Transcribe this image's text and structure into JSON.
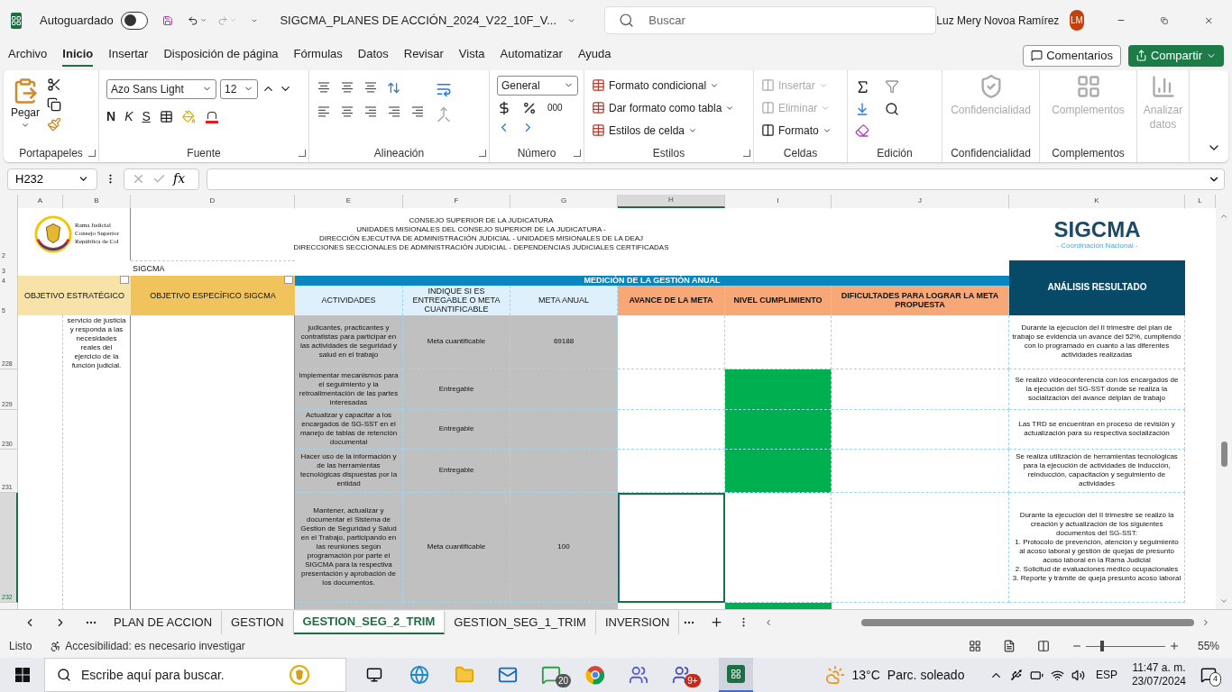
{
  "titlebar": {
    "autosave_label": "Autoguardado",
    "autosave_on": false,
    "filename": "SIGCMA_PLANES DE ACCIÓN_2024_V22_10F_V...",
    "search_placeholder": "Buscar",
    "user_name": "Luz Mery Novoa Ramírez",
    "user_initials": "LM"
  },
  "menu": [
    {
      "label": "Archivo",
      "selected": false
    },
    {
      "label": "Inicio",
      "selected": true
    },
    {
      "label": "Insertar",
      "selected": false
    },
    {
      "label": "Disposición de página",
      "selected": false
    },
    {
      "label": "Fórmulas",
      "selected": false
    },
    {
      "label": "Datos",
      "selected": false
    },
    {
      "label": "Revisar",
      "selected": false
    },
    {
      "label": "Vista",
      "selected": false
    },
    {
      "label": "Automatizar",
      "selected": false
    },
    {
      "label": "Ayuda",
      "selected": false
    }
  ],
  "comments_button": "Comentarios",
  "share_button": "Compartir",
  "ribbon": {
    "paste": "Pegar",
    "font_name": "Azo Sans Light",
    "font_size": "12",
    "bold": "N",
    "italic": "K",
    "underline": "S",
    "number_format": "General",
    "thousands": "000",
    "styles": [
      "Formato condicional",
      "Dar formato como tabla",
      "Estilos de celda"
    ],
    "cells": [
      {
        "label": "Insertar",
        "disabled": true
      },
      {
        "label": "Eliminar",
        "disabled": true
      },
      {
        "label": "Formato",
        "disabled": false
      }
    ],
    "addins": [
      {
        "label": "Confidencialidad",
        "disabled": true
      },
      {
        "label": "Complementos",
        "disabled": true
      },
      {
        "label": "Analizar datos",
        "disabled": true
      }
    ],
    "groups": [
      "Portapapeles",
      "Fuente",
      "Alineación",
      "Número",
      "Estilos",
      "Celdas",
      "Edición",
      "Confidencialidad",
      "Complementos"
    ]
  },
  "formula_bar": {
    "name_box": "H232",
    "fx": "fx"
  },
  "columns": [
    {
      "label": "A",
      "selected": false
    },
    {
      "label": "B",
      "selected": false
    },
    {
      "label": "D",
      "selected": false
    },
    {
      "label": "E",
      "selected": false
    },
    {
      "label": "F",
      "selected": false
    },
    {
      "label": "G",
      "selected": false
    },
    {
      "label": "H",
      "selected": true
    },
    {
      "label": "I",
      "selected": false
    },
    {
      "label": "J",
      "selected": false
    },
    {
      "label": "K",
      "selected": false
    },
    {
      "label": "L",
      "selected": false
    }
  ],
  "header_rows": [
    "2",
    "3",
    "4",
    "5"
  ],
  "logo": {
    "lines": [
      "Rama Judicial",
      "Consejo Superior",
      "República de Col"
    ]
  },
  "org_lines": [
    "CONSEJO SUPERIOR DE LA JUDICATURA",
    "UNIDADES MISIONALES DEL CONSEJO SUPERIOR DE LA JUDICATURA -",
    "DIRECCIÓN EJECUTIVA DE ADMINISTRACIÓN JUDICIAL - UNIDADES MISIONALES DE LA DEAJ",
    "DIRECCIONES SECCIONALES DE ADMINISTRACIÓN JUDICIAL - DEPENDENCIAS JUDICIALES CERTIFICADAS"
  ],
  "sigcma_logo": {
    "name": "SIGCMA",
    "subtitle": "- Coordinación Nacional -"
  },
  "row3_text": "SIGCMA",
  "table": {
    "objective_header": "OBJETIVO ESTRATÉGICO",
    "specific_header": "OBJETIVO ESPECÍFICO SIGCMA",
    "band": "MEDICIÓN DE LA GESTIÓN ANUAL",
    "analysis_header": "ANÁLISIS RESULTADO",
    "columns": [
      "ACTIVIDADES",
      "INDIQUE SI ES ENTREGABLE O META CUANTIFICABLE",
      "META ANUAL",
      "AVANCE DE LA META",
      "NIVEL CUMPLIMIENTO",
      "DIFICULTADES PARA LOGRAR LA META PROPUESTA"
    ],
    "objective": "servicio de justicia y responda a las necesidades reales del ejercicio de la función judicial.",
    "rows": [
      {
        "number": "228",
        "selected": false,
        "activity": "judicantes, practicantes y contratistas para participar en las actividades de seguridad y salud en el trabajo",
        "type": "Meta cuantificable",
        "goal": "69188",
        "compliance_filled": false,
        "advance_selected": false,
        "analysis": [
          "Durante la ejecución del II trimestre del plan de trabajo se evidencia un avance del 52%, cumpliendo con lo programado en cuanto a las diferentes actividades realizadas"
        ]
      },
      {
        "number": "229",
        "selected": false,
        "activity": "Implementar mecanismos para el seguimiento y la retroalimentación de las partes interesadas",
        "type": "Entregable",
        "compliance_filled": true,
        "advance_selected": false,
        "analysis": [
          "Se realizó videoconferencia con los encargados de la ejecución del SG-SST donde se realiza la socialización del avance delplan de trabajo"
        ]
      },
      {
        "number": "230",
        "selected": false,
        "activity": "Actualizar y capacitar a los encargados de SG-SST en el manejo de tablas de retención documental",
        "type": "Entregable",
        "compliance_filled": true,
        "advance_selected": false,
        "analysis": [
          "Las TRD se encuentran en proceso de revisión y actualización para su respectiva socialización"
        ]
      },
      {
        "number": "231",
        "selected": false,
        "activity": "Hacer uso de la información y de las herramientas tecnológicas dispuestas por la entidad",
        "type": "Entregable",
        "compliance_filled": true,
        "advance_selected": false,
        "analysis": [
          "Se realiza utilización de herramientas tecnológicas para la ejecución de actividades de inducción, reinducción, capacitación y seguimiento de actividades"
        ]
      },
      {
        "number": "232",
        "selected": true,
        "activity": "Mantener, actualizar y documentar el  Sistema de Gestion de Seguridad y Salud en el Trabajo, participando en las reuniones según programación por parte el SIGCMA para la respectiva presentación y aprobación de los documentos.",
        "type": "Meta cuantificable",
        "goal": "100",
        "compliance_filled": false,
        "advance_selected": true,
        "analysis": [
          "Durante la ejecución del II trimestre se realizó la creación y actualización de los siguientes documentos del SG-SST:",
          "1. Protocolo de prevención, atención y seguimiento al acoso laboral y gestión de quejas de presunto acoso laboral en la Rama Judicial",
          "2. Solicitud de evaluaciones médico ocupacionales",
          "3. Reporte y trámite de queja presunto acoso laboral"
        ]
      }
    ],
    "partial_row": {
      "compliance_filled": true
    }
  },
  "sheet_tabs": [
    {
      "label": "PLAN DE ACCION",
      "selected": false
    },
    {
      "label": "GESTION",
      "selected": false
    },
    {
      "label": "GESTION_SEG_2_TRIM",
      "selected": true
    },
    {
      "label": "GESTION_SEG_1_TRIM",
      "selected": false
    },
    {
      "label": "INVERSION",
      "selected": false
    }
  ],
  "status_bar": {
    "ready": "Listo",
    "accessibility": "Accesibilidad: es necesario investigar",
    "zoom": "55%",
    "zoom_slider": {
      "level": 0.2
    }
  },
  "taskbar": {
    "search_placeholder": "Escribe aquí para buscar.",
    "chat_badge": "20",
    "teams_badge": "9+",
    "temperature": "13°C",
    "weather": "Parc. soleado",
    "language": "ESP",
    "time": "11:47 a. m.",
    "date": "23/07/2024",
    "notifications": "4"
  }
}
